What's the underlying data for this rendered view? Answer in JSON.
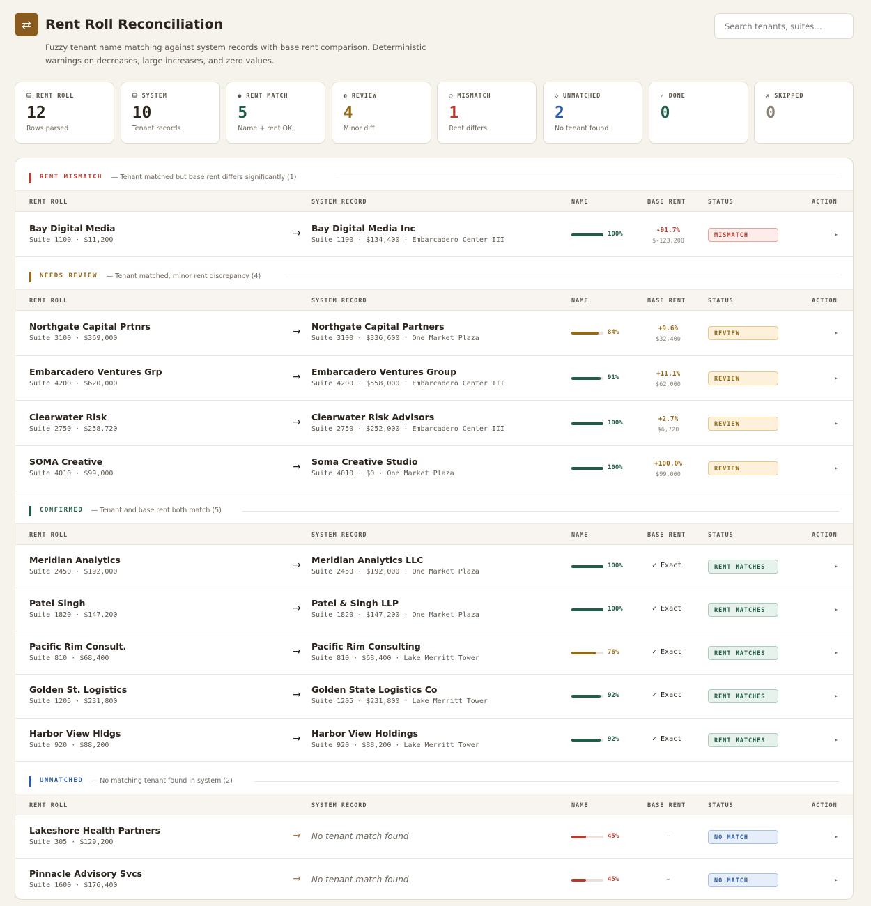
{
  "header": {
    "logo_icon": "⇄",
    "title": "Rent Roll Reconciliation",
    "subtitle": "Fuzzy tenant name matching against system records with base rent comparison. Deterministic warnings on decreases, large increases, and zero values.",
    "search_placeholder": "Search tenants, suites…"
  },
  "stats": [
    {
      "icon": "⛁",
      "label": "RENT ROLL",
      "value": "12",
      "sub": "Rows parsed",
      "color": "#2b241d"
    },
    {
      "icon": "⛁",
      "label": "SYSTEM",
      "value": "10",
      "sub": "Tenant records",
      "color": "#2b241d"
    },
    {
      "icon": "●",
      "label": "RENT MATCH",
      "value": "5",
      "sub": "Name + rent OK",
      "color": "#1f5c4a"
    },
    {
      "icon": "◐",
      "label": "REVIEW",
      "value": "4",
      "sub": "Minor diff",
      "color": "#93691a"
    },
    {
      "icon": "○",
      "label": "MISMATCH",
      "value": "1",
      "sub": "Rent differs",
      "color": "#b83a2e"
    },
    {
      "icon": "◇",
      "label": "UNMATCHED",
      "value": "2",
      "sub": "No tenant found",
      "color": "#2a5aa8"
    },
    {
      "icon": "✓",
      "label": "DONE",
      "value": "0",
      "sub": "",
      "color": "#1f5c4a"
    },
    {
      "icon": "✗",
      "label": "SKIPPED",
      "value": "0",
      "sub": "",
      "color": "#8a8279"
    }
  ],
  "columns": {
    "rent_roll": "RENT ROLL",
    "system": "SYSTEM RECORD",
    "name": "NAME",
    "base_rent": "BASE RENT",
    "status": "STATUS",
    "action": "ACTION"
  },
  "sections": [
    {
      "title": "RENT MISMATCH",
      "desc": "— Tenant matched but base rent differs significantly (1)",
      "color": "#b83a2e",
      "rows": [
        {
          "rr_name": "Bay Digital Media",
          "rr_sub": "Suite 1100 · $11,200",
          "sys_name": "Bay Digital Media Inc",
          "sys_sub": "Suite 1100 · $134,400 · Embarcadero Center III",
          "score": 100,
          "pct": "100%",
          "rent_main": "-91.7%",
          "rent_sub": "$-123,200",
          "status": "MISMATCH",
          "kind": "mismatch",
          "action": "▸"
        }
      ]
    },
    {
      "title": "NEEDS REVIEW",
      "desc": "— Tenant matched, minor rent discrepancy (4)",
      "color": "#93691a",
      "rows": [
        {
          "rr_name": "Northgate Capital Prtnrs",
          "rr_sub": "Suite 3100 · $369,000",
          "sys_name": "Northgate Capital Partners",
          "sys_sub": "Suite 3100 · $336,600 · One Market Plaza",
          "score": 84,
          "pct": "84%",
          "rent_main": "+9.6%",
          "rent_sub": "$32,400",
          "status": "REVIEW",
          "kind": "review",
          "action": "▸"
        },
        {
          "rr_name": "Embarcadero Ventures Grp",
          "rr_sub": "Suite 4200 · $620,000",
          "sys_name": "Embarcadero Ventures Group",
          "sys_sub": "Suite 4200 · $558,000 · Embarcadero Center III",
          "score": 91,
          "pct": "91%",
          "rent_main": "+11.1%",
          "rent_sub": "$62,000",
          "status": "REVIEW",
          "kind": "review",
          "action": "▸"
        },
        {
          "rr_name": "Clearwater Risk",
          "rr_sub": "Suite 2750 · $258,720",
          "sys_name": "Clearwater Risk Advisors",
          "sys_sub": "Suite 2750 · $252,000 · Embarcadero Center III",
          "score": 100,
          "pct": "100%",
          "rent_main": "+2.7%",
          "rent_sub": "$6,720",
          "status": "REVIEW",
          "kind": "review",
          "action": "▸"
        },
        {
          "rr_name": "SOMA Creative",
          "rr_sub": "Suite 4010 · $99,000",
          "sys_name": "Soma Creative Studio",
          "sys_sub": "Suite 4010 · $0 · One Market Plaza",
          "score": 100,
          "pct": "100%",
          "rent_main": "+100.0%",
          "rent_sub": "$99,000",
          "status": "REVIEW",
          "kind": "review",
          "action": "▸"
        }
      ]
    },
    {
      "title": "CONFIRMED",
      "desc": "— Tenant and base rent both match (5)",
      "color": "#1f5c4a",
      "rows": [
        {
          "rr_name": "Meridian Analytics",
          "rr_sub": "Suite 2450 · $192,000",
          "sys_name": "Meridian Analytics LLC",
          "sys_sub": "Suite 2450 · $192,000 · One Market Plaza",
          "score": 100,
          "pct": "100%",
          "exact": "✓ Exact",
          "status": "RENT MATCHES",
          "kind": "match",
          "action": "▸"
        },
        {
          "rr_name": "Patel Singh",
          "rr_sub": "Suite 1820 · $147,200",
          "sys_name": "Patel & Singh LLP",
          "sys_sub": "Suite 1820 · $147,200 · One Market Plaza",
          "score": 100,
          "pct": "100%",
          "exact": "✓ Exact",
          "status": "RENT MATCHES",
          "kind": "match",
          "action": "▸"
        },
        {
          "rr_name": "Pacific Rim Consult.",
          "rr_sub": "Suite 810 · $68,400",
          "sys_name": "Pacific Rim Consulting",
          "sys_sub": "Suite 810 · $68,400 · Lake Merritt Tower",
          "score": 76,
          "pct": "76%",
          "exact": "✓ Exact",
          "status": "RENT MATCHES",
          "kind": "match",
          "action": "▸"
        },
        {
          "rr_name": "Golden St. Logistics",
          "rr_sub": "Suite 1205 · $231,800",
          "sys_name": "Golden State Logistics Co",
          "sys_sub": "Suite 1205 · $231,800 · Lake Merritt Tower",
          "score": 92,
          "pct": "92%",
          "exact": "✓ Exact",
          "status": "RENT MATCHES",
          "kind": "match",
          "action": "▸"
        },
        {
          "rr_name": "Harbor View Hldgs",
          "rr_sub": "Suite 920 · $88,200",
          "sys_name": "Harbor View Holdings",
          "sys_sub": "Suite 920 · $88,200 · Lake Merritt Tower",
          "score": 92,
          "pct": "92%",
          "exact": "✓ Exact",
          "status": "RENT MATCHES",
          "kind": "match",
          "action": "▸"
        }
      ]
    },
    {
      "title": "UNMATCHED",
      "desc": "— No matching tenant found in system (2)",
      "color": "#2a5aa8",
      "rows": [
        {
          "rr_name": "Lakeshore Health Partners",
          "rr_sub": "Suite 305 · $129,200",
          "nomatch": "No tenant match found",
          "score": 45,
          "pct": "45%",
          "dash": "–",
          "status": "NO MATCH",
          "kind": "nomatch",
          "action": "▸"
        },
        {
          "rr_name": "Pinnacle Advisory Svcs",
          "rr_sub": "Suite 1600 · $176,400",
          "nomatch": "No tenant match found",
          "score": 45,
          "pct": "45%",
          "dash": "–",
          "status": "NO MATCH",
          "kind": "nomatch",
          "action": "▸"
        }
      ]
    }
  ]
}
